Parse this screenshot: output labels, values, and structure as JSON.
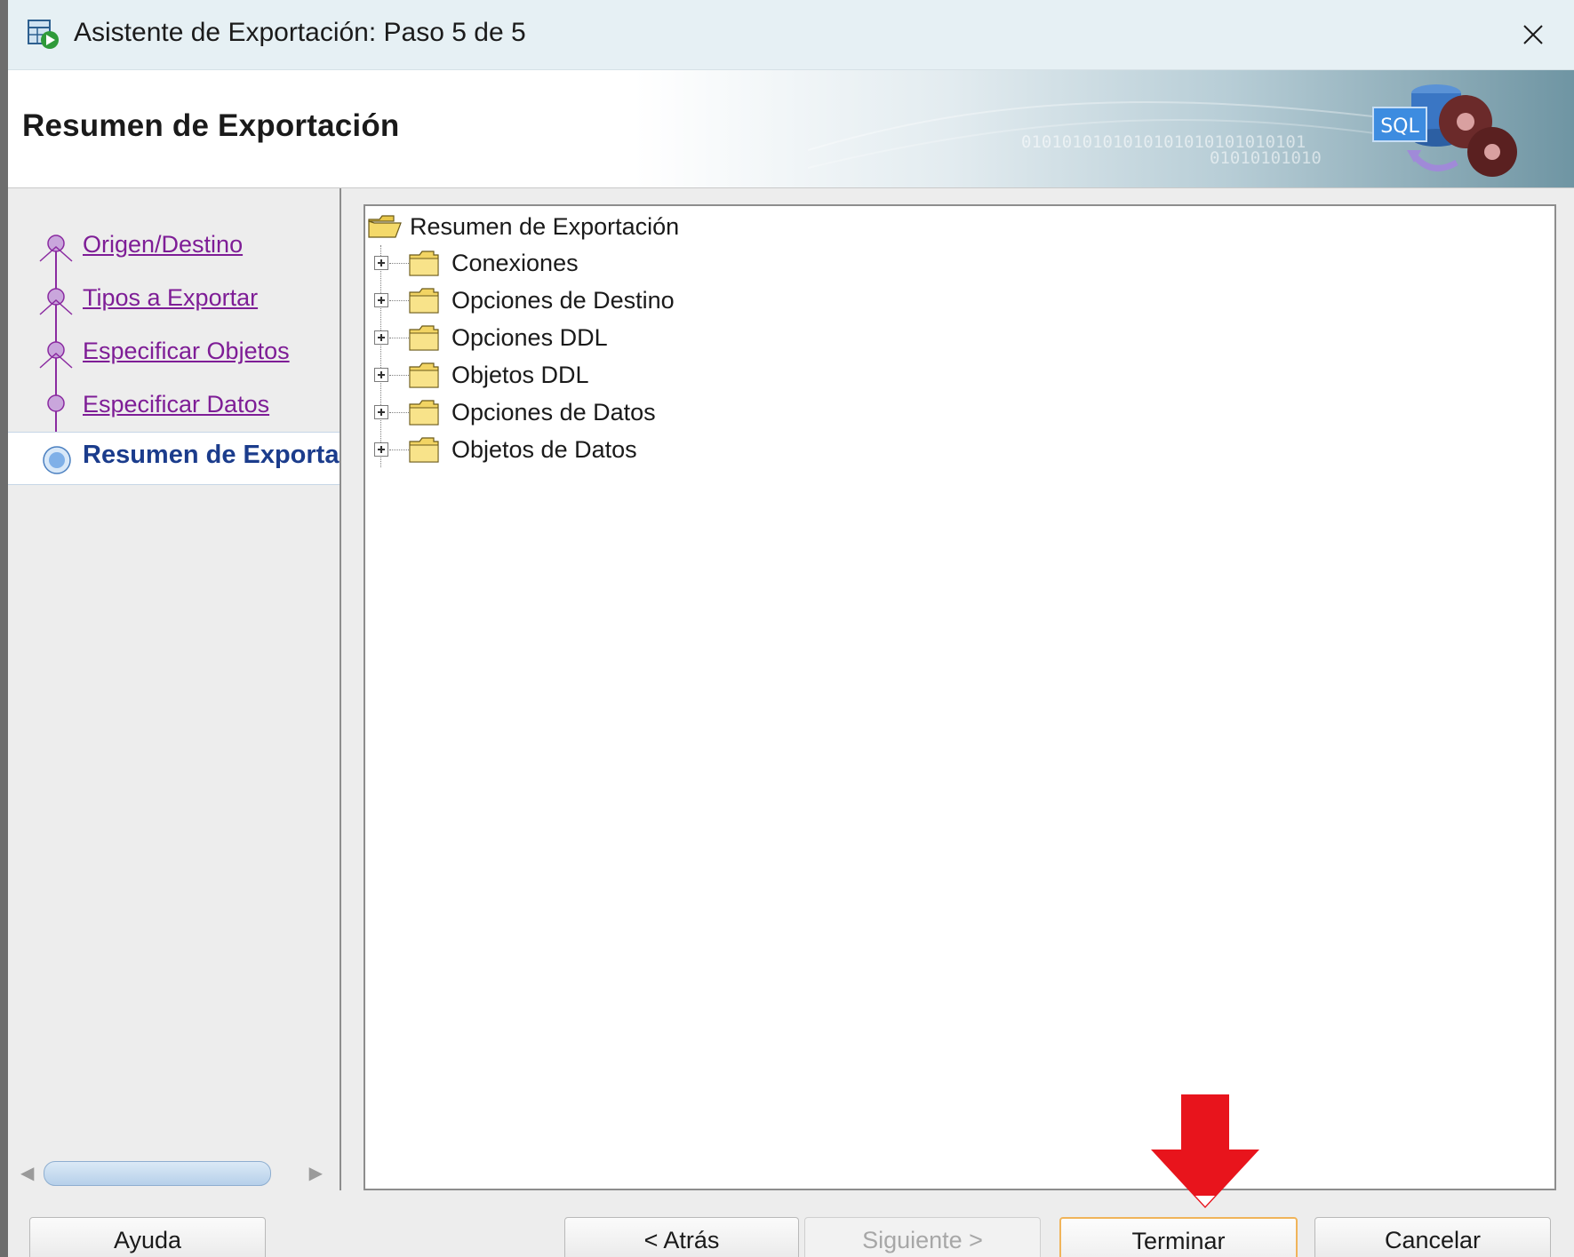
{
  "window": {
    "title": "Asistente de Exportación: Paso 5 de 5",
    "app_icon": "export-wizard-icon",
    "close_icon": "close-icon"
  },
  "header": {
    "title": "Resumen de Exportación",
    "binary_line_1": "0101010101010101010101010101",
    "binary_line_2": "01010101010",
    "art_icon": "sql-database-reels-icon",
    "art_label": "SQL"
  },
  "steps": [
    {
      "label": "Origen/Destino",
      "state": "visited"
    },
    {
      "label": "Tipos a Exportar",
      "state": "visited"
    },
    {
      "label": "Especificar Objetos",
      "state": "visited"
    },
    {
      "label": "Especificar Datos",
      "state": "visited"
    },
    {
      "label": "Resumen de Exporta",
      "state": "current"
    }
  ],
  "tree": {
    "root_label": "Resumen de Exportación",
    "root_icon": "open-folder-icon",
    "nodes": [
      {
        "label": "Conexiones"
      },
      {
        "label": "Opciones de Destino"
      },
      {
        "label": "Opciones DDL"
      },
      {
        "label": "Objetos DDL"
      },
      {
        "label": "Opciones de Datos"
      },
      {
        "label": "Objetos de Datos"
      }
    ]
  },
  "buttons": {
    "help": "Ayuda",
    "back": "< Atrás",
    "next": "Siguiente >",
    "finish": "Terminar",
    "cancel": "Cancelar"
  },
  "annotation": {
    "arrow_icon": "red-down-arrow-icon",
    "color": "#e8141c"
  },
  "colors": {
    "link_visited": "#7e1d96",
    "current_step": "#1b3c8c",
    "default_button_border": "#f0b45a"
  }
}
